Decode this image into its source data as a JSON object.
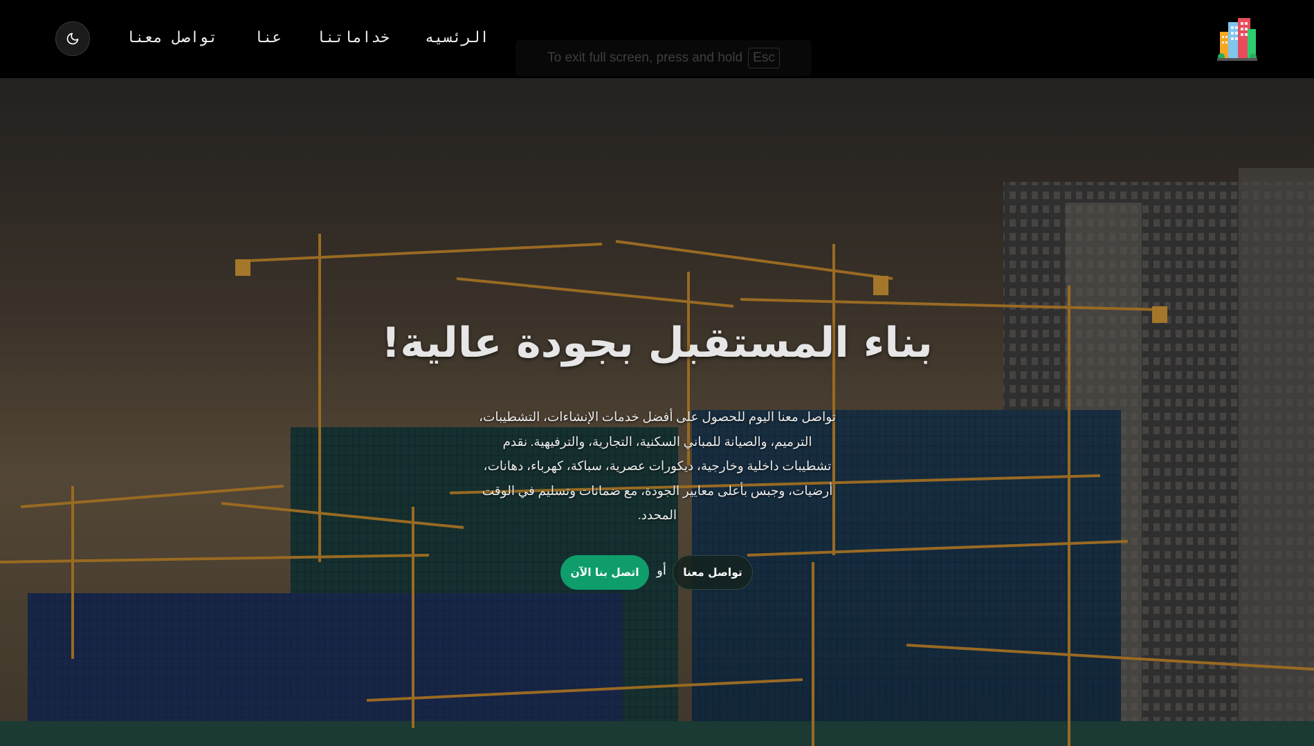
{
  "nav": {
    "home": "الرئسيه",
    "services": "خداماتنا",
    "about": "عنا",
    "contact": "تواصل معنا"
  },
  "fullscreen_hint": {
    "text": "To exit full screen, press and hold",
    "key": "Esc"
  },
  "hero": {
    "title": "بناء المستقبل بجودة عالية!",
    "description": "تواصل معنا اليوم للحصول على أفضل خدمات الإنشاءات، التشطيبات، الترميم، والصيانة للمباني السكنية، التجارية، والترفيهية. نقدم تشطيبات داخلية وخارجية، ديكورات عصرية، سباكة، كهرباء، دهانات، أرضيات، وجبس بأعلى معايير الجودة، مع ضمانات وتسليم في الوقت المحدد.",
    "contact_button": "تواصل معنا",
    "or_text": "أو",
    "call_button": "اتصل بنا الآن"
  },
  "icons": {
    "logo": "buildings-logo-icon",
    "theme": "moon-icon"
  },
  "colors": {
    "navbar_bg": "#000000",
    "primary_button": "#0f9d6b",
    "secondary_button": "#14221e"
  }
}
